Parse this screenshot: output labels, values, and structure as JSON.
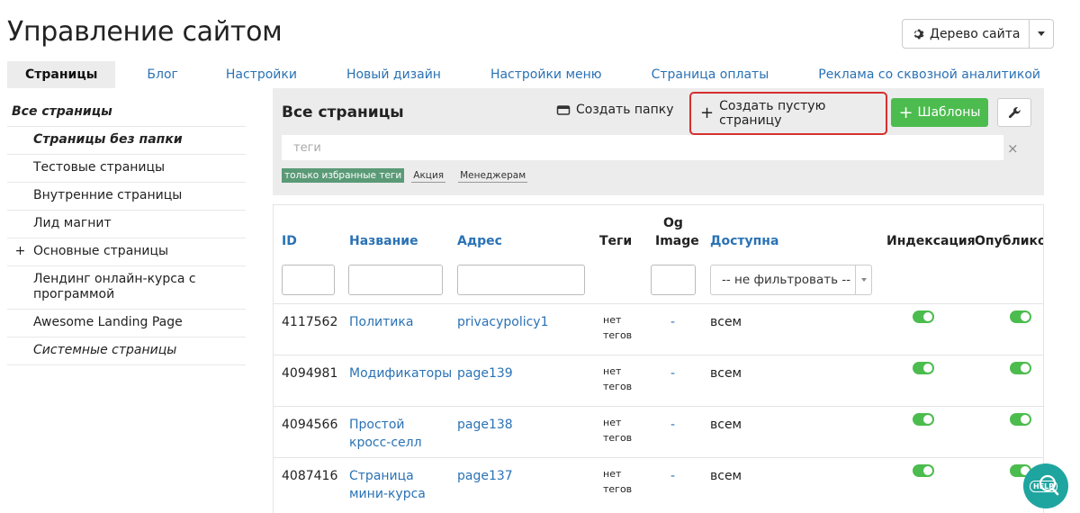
{
  "title": "Управление сайтом",
  "site_tree": {
    "label": "Дерево сайта",
    "icon": "gear-icon"
  },
  "tabs": [
    {
      "label": "Страницы",
      "active": true
    },
    {
      "label": "Блог"
    },
    {
      "label": "Настройки"
    },
    {
      "label": "Новый дизайн"
    },
    {
      "label": "Настройки меню"
    },
    {
      "label": "Страница оплаты"
    },
    {
      "label": "Реклама со сквозной аналитикой"
    }
  ],
  "sidebar": {
    "items": [
      {
        "label": "Все страницы"
      },
      {
        "label": "Страницы без папки"
      },
      {
        "label": "Тестовые страницы"
      },
      {
        "label": "Внутренние страницы"
      },
      {
        "label": "Лид магнит"
      },
      {
        "label": "Основные страницы",
        "expand": "+"
      },
      {
        "label": "Лендинг онлайн-курса с программой"
      },
      {
        "label": "Awesome Landing Page"
      },
      {
        "label": "Системные страницы"
      }
    ]
  },
  "panel": {
    "title": "Все страницы",
    "create_folder": "Создать папку",
    "create_empty": "Создать пустую страницу",
    "templates": "Шаблоны",
    "tags_placeholder": "теги",
    "clear": "×",
    "tag_filter": "только избранные теги",
    "tags": [
      "Акция",
      "Менеджерам"
    ]
  },
  "table": {
    "headers": {
      "id": "ID",
      "name": "Название",
      "address": "Адрес",
      "tags": "Теги",
      "og_image": "Og Image",
      "og_line1": "Og",
      "og_line2": "Image",
      "access": "Доступна",
      "indexing": "Индексация",
      "published": "Опубликов"
    },
    "access_filter": "-- не фильтровать --",
    "rows": [
      {
        "id": "4117562",
        "name": "Политика",
        "address": "privacypolicy1",
        "tags": "нет тегов",
        "tags1": "нет",
        "tags2": "тегов",
        "og": "-",
        "access": "всем",
        "indexing": true,
        "published": true
      },
      {
        "id": "4094981",
        "name": "Модификаторы",
        "address": "page139",
        "tags": "нет тегов",
        "tags1": "нет",
        "tags2": "тегов",
        "og": "-",
        "access": "всем",
        "indexing": true,
        "published": true
      },
      {
        "id": "4094566",
        "name": "Простой кросс-селл",
        "name1": "Простой",
        "name2": "кросс-селл",
        "address": "page138",
        "tags": "нет тегов",
        "tags1": "нет",
        "tags2": "тегов",
        "og": "-",
        "access": "всем",
        "indexing": true,
        "published": true
      },
      {
        "id": "4087416",
        "name": "Страница мини-курса",
        "name1": "Страница",
        "name2": "мини-курса",
        "address": "page137",
        "tags": "нет тегов",
        "tags1": "нет",
        "tags2": "тегов",
        "og": "-",
        "access": "всем",
        "indexing": true,
        "published": true
      }
    ]
  },
  "help": {
    "label": "HELP",
    "icon": "search-icon",
    "color": "#1fa5a0"
  },
  "colors": {
    "link": "#2a72b5",
    "green": "#4cbc4e",
    "highlight": "#d62f2f",
    "tag_fav": "#5a9a76"
  }
}
